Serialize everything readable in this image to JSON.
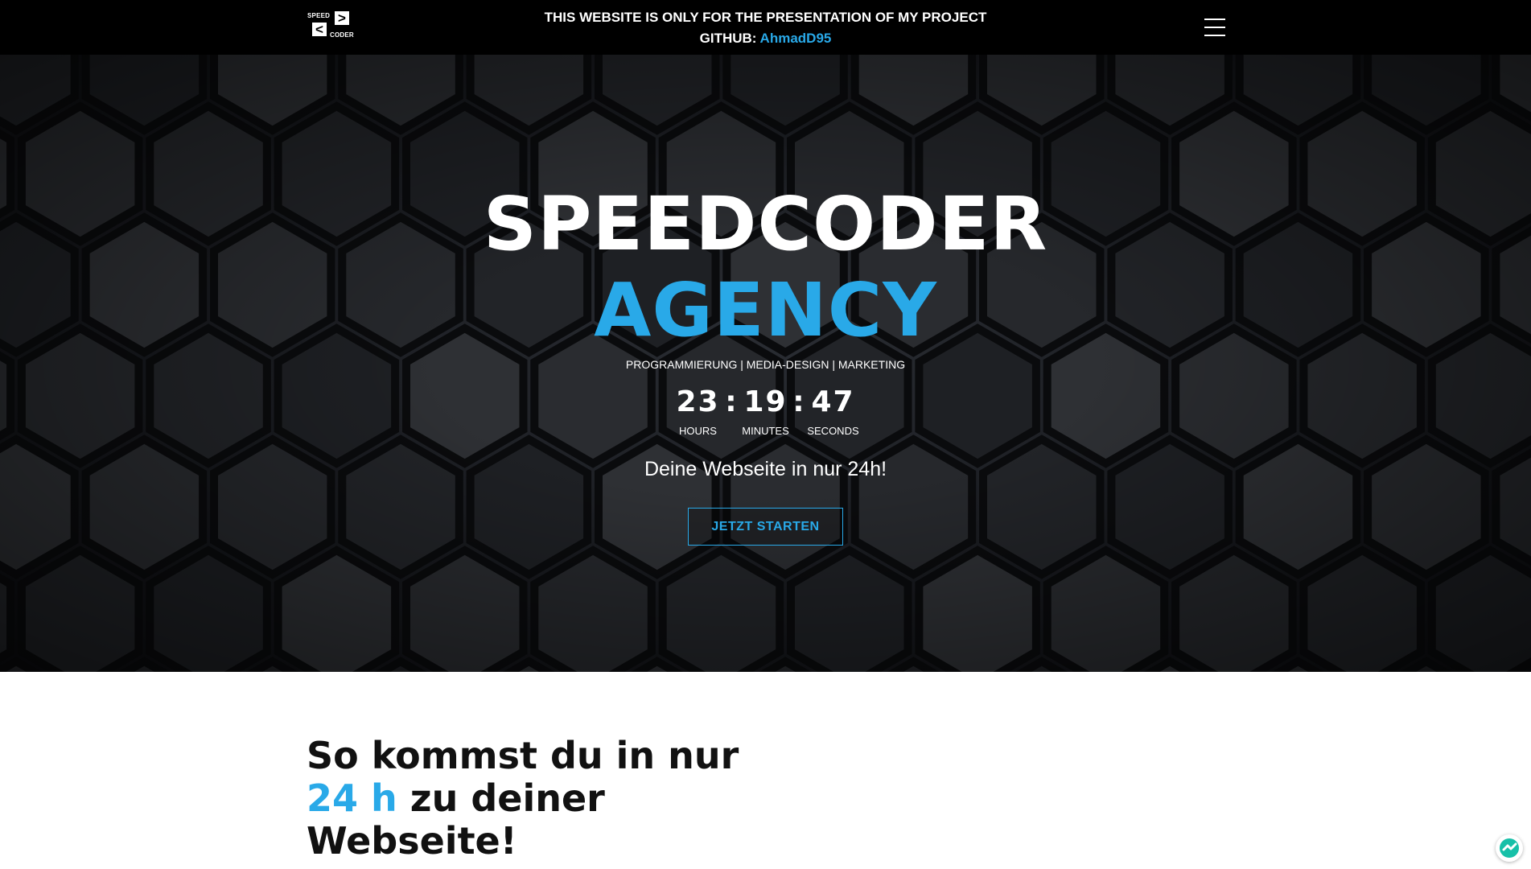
{
  "header": {
    "logo": {
      "word_top": "SPEED",
      "word_bottom": "CODER",
      "glyph_right": ">",
      "glyph_left": "<"
    },
    "notice_line1": "THIS WEBSITE IS ONLY FOR THE PRESENTATION OF MY PROJECT",
    "notice_github_label": "GITHUB:",
    "notice_github_user": "AhmadD95",
    "menu_icon": "hamburger-icon"
  },
  "hero": {
    "title_line1": "SPEEDCODER",
    "title_line2": "AGENCY",
    "services": "PROGRAMMIERUNG | MEDIA-DESIGN | MARKETING",
    "countdown": {
      "hours": "23",
      "minutes": "19",
      "seconds": "47",
      "separator": ":",
      "hours_label": "HOURS",
      "minutes_label": "MINUTES",
      "seconds_label": "SECONDS"
    },
    "tagline": "Deine Webseite in nur 24h!",
    "cta_label": "JETZT STARTEN"
  },
  "section": {
    "title_part1": "So kommst du in nur",
    "title_accent": "24 h",
    "title_part2": "zu deiner",
    "title_part3": "Webseite!"
  },
  "colors": {
    "accent": "#29a9e8",
    "topbar": "#000000",
    "text_dark": "#111111"
  },
  "widget": {
    "icon": "chat-widget-icon"
  }
}
